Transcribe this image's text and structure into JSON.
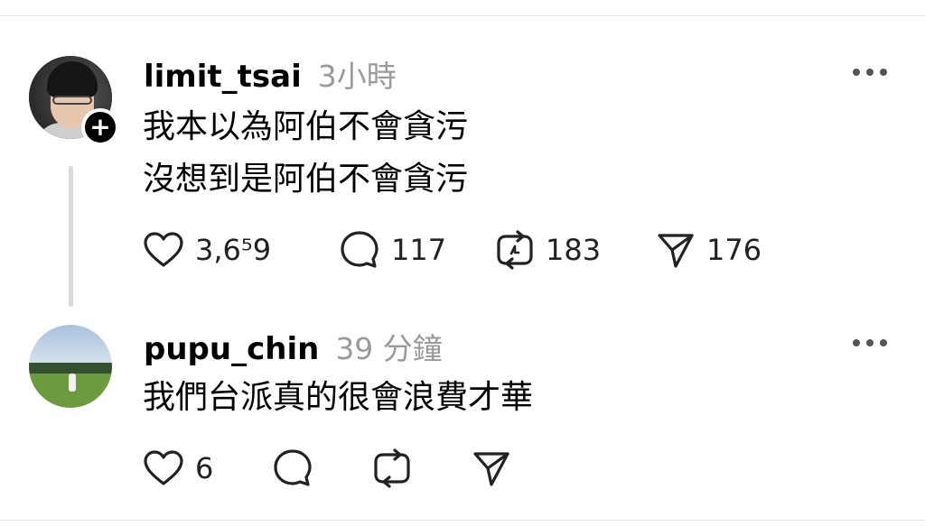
{
  "posts": [
    {
      "username": "limit_tsai",
      "time": "3小時",
      "lines": [
        "我本以為阿伯不會貪污",
        "沒想到是阿伯不會貪污"
      ],
      "counts": {
        "likes": "3,6⁵9",
        "replies": "117",
        "reposts": "183",
        "shares": "176"
      },
      "icons": {
        "follow": "+",
        "more": "more-icon"
      }
    },
    {
      "username": "pupu_chin",
      "time": "39 分鐘",
      "lines": [
        "我們台派真的很會浪費才華"
      ],
      "counts": {
        "likes": "6"
      },
      "icons": {
        "more": "more-icon"
      }
    }
  ]
}
